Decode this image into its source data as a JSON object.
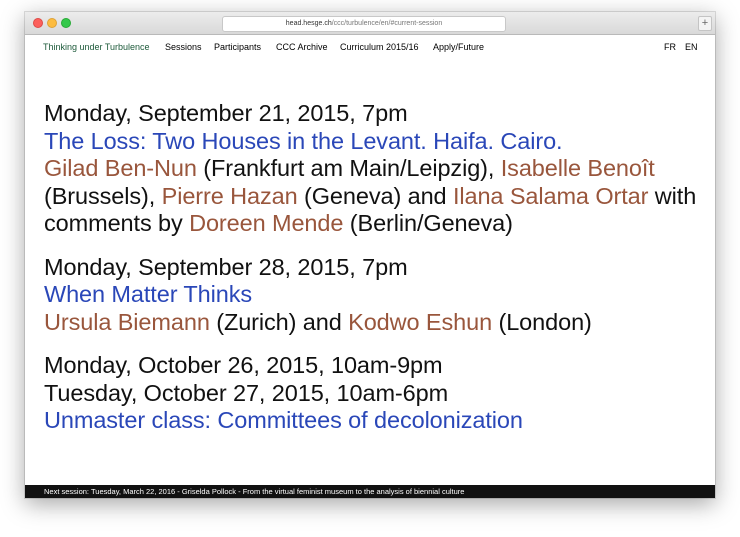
{
  "browser": {
    "url_host": "head.hesge.ch",
    "url_path": "/ccc/turbulence/en/#current-session",
    "new_tab_label": "+"
  },
  "nav": {
    "brand": "Thinking under Turbulence",
    "items": [
      "Sessions",
      "Participants",
      "CCC Archive",
      "Curriculum 2015/16",
      "Apply/Future"
    ],
    "lang": [
      "FR",
      "EN"
    ]
  },
  "sessions": [
    {
      "date": "Monday, September 21, 2015, 7pm",
      "title": "The Loss: Two Houses in the Levant. Haifa. Cairo.",
      "p1": "Gilad Ben-Nun",
      "l1": " (Frankfurt am Main/Leipzig), ",
      "p2": "Isabelle Benoît",
      "l2": " (Brussels), ",
      "p3": "Pierre Hazan",
      "l3": " (Geneva) and ",
      "p4": "Ilana Salama Ortar",
      "l4": " with comments by ",
      "p5": "Doreen Mende",
      "l5": " (Berlin/Geneva)"
    },
    {
      "date": "Monday, September 28, 2015, 7pm",
      "title": "When Matter Thinks",
      "p1": "Ursula Biemann",
      "l1": " (Zurich) and ",
      "p2": "Kodwo Eshun",
      "l2": " (London)"
    },
    {
      "date": "Monday, October 26, 2015, 10am-9pm",
      "date2": "Tuesday, October 27, 2015, 10am-6pm",
      "title": "Unmaster class: Committees of decolonization"
    }
  ],
  "footer": {
    "text": "Next session: Tuesday, March 22, 2016 - Griselda Pollock - From the virtual feminist museum to the analysis of biennial culture"
  },
  "colors": {
    "title_blue": "#2a47b8",
    "person_brown": "#99563c",
    "brand_green": "#1d5a3a"
  }
}
